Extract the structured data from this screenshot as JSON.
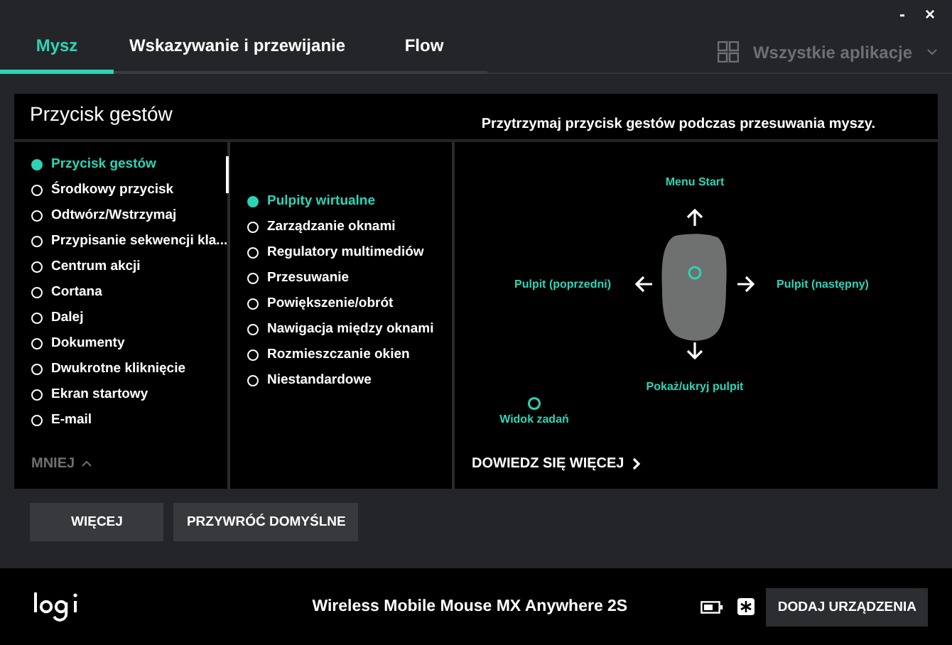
{
  "window": {
    "controls": [
      "-",
      "×"
    ]
  },
  "tabs": [
    {
      "label": "Mysz",
      "selected": true
    },
    {
      "label": "Wskazywanie i przewijanie",
      "selected": false
    },
    {
      "label": "Flow",
      "selected": false
    }
  ],
  "app_selector": {
    "label": "Wszystkie aplikacje"
  },
  "panel": {
    "title": "Przycisk gestów",
    "hint": "Przytrzymaj przycisk gestów podczas przesuwania myszy.",
    "actions": [
      {
        "label": "Przycisk gestów",
        "selected": true
      },
      {
        "label": "Środkowy przycisk",
        "selected": false
      },
      {
        "label": "Odtwórz/Wstrzymaj",
        "selected": false
      },
      {
        "label": "Przypisanie sekwencji kla...",
        "selected": false
      },
      {
        "label": "Centrum akcji",
        "selected": false
      },
      {
        "label": "Cortana",
        "selected": false
      },
      {
        "label": "Dalej",
        "selected": false
      },
      {
        "label": "Dokumenty",
        "selected": false
      },
      {
        "label": "Dwukrotne kliknięcie",
        "selected": false
      },
      {
        "label": "Ekran startowy",
        "selected": false
      },
      {
        "label": "E-mail",
        "selected": false
      }
    ],
    "collapse": "MNIEJ",
    "gestures": [
      {
        "label": "Pulpity wirtualne",
        "selected": true
      },
      {
        "label": "Zarządzanie oknami",
        "selected": false
      },
      {
        "label": "Regulatory multimediów",
        "selected": false
      },
      {
        "label": "Przesuwanie",
        "selected": false
      },
      {
        "label": "Powiększenie/obrót",
        "selected": false
      },
      {
        "label": "Nawigacja między oknami",
        "selected": false
      },
      {
        "label": "Rozmieszczanie okien",
        "selected": false
      },
      {
        "label": "Niestandardowe",
        "selected": false
      }
    ],
    "diagram": {
      "up": "Menu Start",
      "left": "Pulpit (poprzedni)",
      "right": "Pulpit (następny)",
      "down": "Pokaż/ukryj pulpit",
      "press": "Widok zadań"
    },
    "learn_more": "DOWIEDZ SIĘ WIĘCEJ"
  },
  "buttons": [
    "WIĘCEJ",
    "PRZYWRÓĆ DOMYŚLNE"
  ],
  "footer": {
    "device": "Wireless Mobile Mouse MX Anywhere 2S",
    "add_button": "DODAJ URZĄDZENIA"
  }
}
